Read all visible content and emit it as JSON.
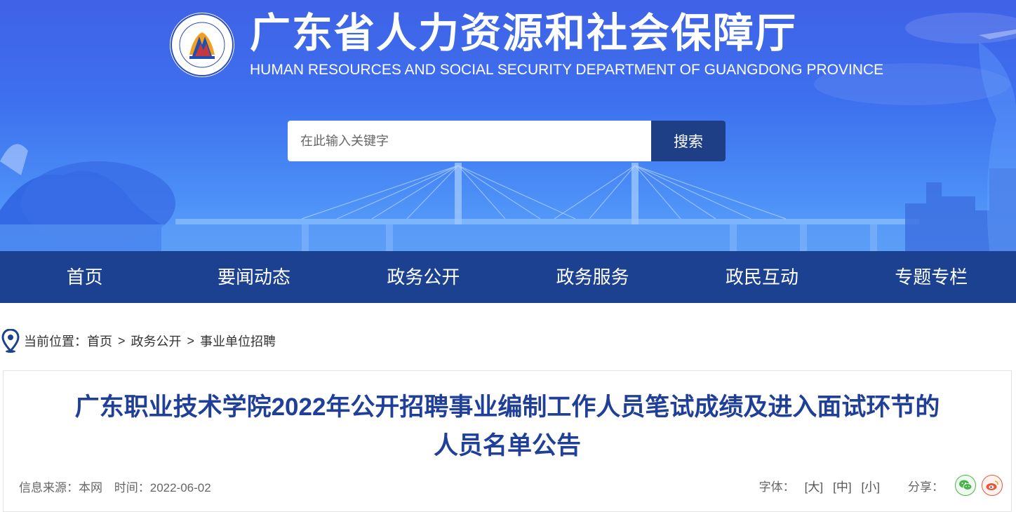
{
  "header": {
    "title_cn": "广东省人力资源和社会保障厅",
    "title_en": "HUMAN RESOURCES AND SOCIAL SECURITY DEPARTMENT OF GUANGDONG PROVINCE"
  },
  "search": {
    "placeholder": "在此输入关键字",
    "button_label": "搜索"
  },
  "nav": {
    "items": [
      {
        "label": "首页"
      },
      {
        "label": "要闻动态"
      },
      {
        "label": "政务公开"
      },
      {
        "label": "政务服务"
      },
      {
        "label": "政民互动"
      },
      {
        "label": "专题专栏"
      }
    ]
  },
  "breadcrumb": {
    "prefix": "当前位置：",
    "items": [
      "首页",
      "政务公开",
      "事业单位招聘"
    ],
    "separator": ">"
  },
  "article": {
    "title_line1": "广东职业技术学院2022年公开招聘事业编制工作人员笔试成绩及进入面试环节的",
    "title_line2": "人员名单公告",
    "source_label": "信息来源：本网",
    "time_label": "时间：2022-06-02",
    "font_label": "字体：",
    "font_sizes": [
      "[大]",
      "[中]",
      "[小]"
    ],
    "share_label": "分享："
  },
  "colors": {
    "nav_bg": "#1c4190",
    "search_button": "#1e3f86",
    "title_text": "#1f3f98",
    "wechat": "#4cb34c",
    "weibo": "#e6553c"
  },
  "icons": [
    "logo-emblem",
    "location-pin-icon",
    "wechat-icon",
    "weibo-icon"
  ]
}
